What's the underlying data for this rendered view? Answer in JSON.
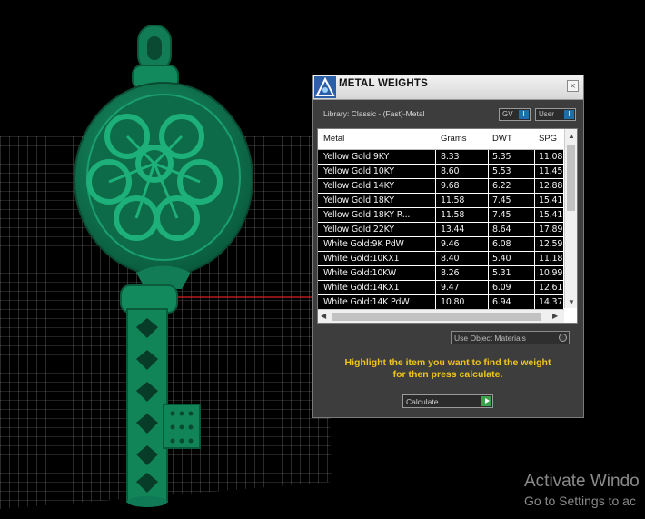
{
  "panel": {
    "title": "METAL WEIGHTS",
    "close": "×",
    "library_label": "Library: Classic - (Fast)-Metal",
    "gv_label": "GV",
    "user_label": "User",
    "columns": [
      "Metal",
      "Grams",
      "DWT",
      "SPG"
    ],
    "rows": [
      [
        "Yellow Gold:9KY",
        "8.33",
        "5.35",
        "11.08"
      ],
      [
        "Yellow Gold:10KY",
        "8.60",
        "5.53",
        "11.45"
      ],
      [
        "Yellow Gold:14KY",
        "9.68",
        "6.22",
        "12.88"
      ],
      [
        "Yellow Gold:18KY",
        "11.58",
        "7.45",
        "15.41"
      ],
      [
        "Yellow Gold:18KY R...",
        "11.58",
        "7.45",
        "15.41"
      ],
      [
        "Yellow Gold:22KY",
        "13.44",
        "8.64",
        "17.89"
      ],
      [
        "White Gold:9K PdW",
        "9.46",
        "6.08",
        "12.59"
      ],
      [
        "White Gold:10KX1",
        "8.40",
        "5.40",
        "11.18"
      ],
      [
        "White Gold:10KW",
        "8.26",
        "5.31",
        "10.99"
      ],
      [
        "White Gold:14KX1",
        "9.47",
        "6.09",
        "12.61"
      ],
      [
        "White Gold:14K PdW",
        "10.80",
        "6.94",
        "14.37"
      ]
    ],
    "use_object_materials": "Use Object Materials",
    "hint_line1": "Highlight the item you want to find the weight",
    "hint_line2": "for then press calculate.",
    "calculate_label": "Calculate"
  },
  "watermark": {
    "line1": "Activate Windo",
    "line2": "Go to Settings to ac"
  },
  "colors": {
    "model_green": "#0f7a55",
    "hint_yellow": "#f0c419",
    "panel_bg": "#3d3d3d"
  }
}
